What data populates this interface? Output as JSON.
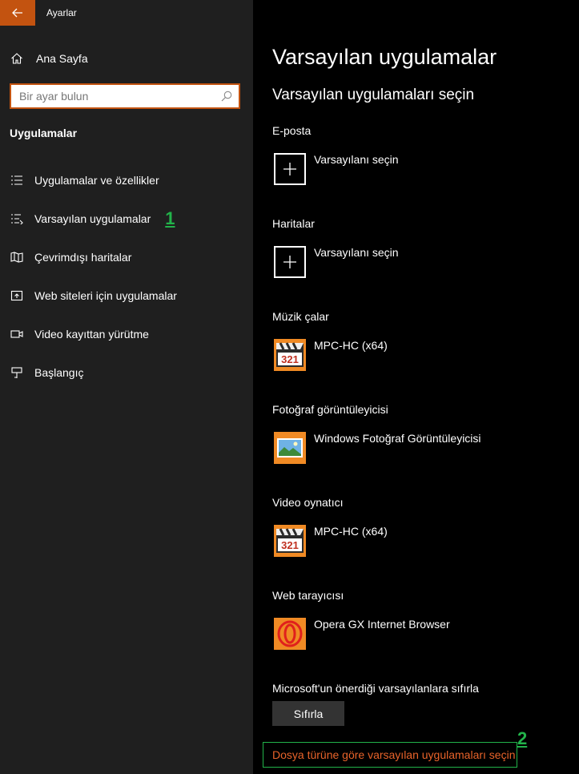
{
  "window": {
    "title": "Ayarlar",
    "accent": "#c35310"
  },
  "sidebar": {
    "home_label": "Ana Sayfa",
    "search_placeholder": "Bir ayar bulun",
    "section_title": "Uygulamalar",
    "items": [
      {
        "label": "Uygulamalar ve özellikler",
        "icon": "list-icon"
      },
      {
        "label": "Varsayılan uygulamalar",
        "icon": "default-apps-icon",
        "marker": "1"
      },
      {
        "label": "Çevrimdışı haritalar",
        "icon": "map-icon"
      },
      {
        "label": "Web siteleri için uygulamalar",
        "icon": "web-app-icon"
      },
      {
        "label": "Video kayıttan yürütme",
        "icon": "video-icon"
      },
      {
        "label": "Başlangıç",
        "icon": "startup-icon"
      }
    ]
  },
  "main": {
    "title": "Varsayılan uygulamalar",
    "subtitle": "Varsayılan uygulamaları seçin",
    "categories": [
      {
        "label": "E-posta",
        "app": "Varsayılanı seçin",
        "icon": "plus-icon"
      },
      {
        "label": "Haritalar",
        "app": "Varsayılanı seçin",
        "icon": "plus-icon"
      },
      {
        "label": "Müzik çalar",
        "app": "MPC-HC (x64)",
        "icon": "mpc-hc-icon"
      },
      {
        "label": "Fotoğraf görüntüleyicisi",
        "app": "Windows Fotoğraf Görüntüleyicisi",
        "icon": "photo-viewer-icon"
      },
      {
        "label": "Video oynatıcı",
        "app": "MPC-HC (x64)",
        "icon": "mpc-hc-icon"
      },
      {
        "label": "Web tarayıcısı",
        "app": "Opera GX Internet Browser",
        "icon": "opera-gx-icon"
      }
    ],
    "reset_label": "Microsoft'un önerdiği varsayılanlara sıfırla",
    "reset_button": "Sıfırla",
    "file_type_link": "Dosya türüne göre varsayılan uygulamaları seçin",
    "marker2": "2",
    "link_color": "#e8632a",
    "marker_color": "#22b34a"
  }
}
